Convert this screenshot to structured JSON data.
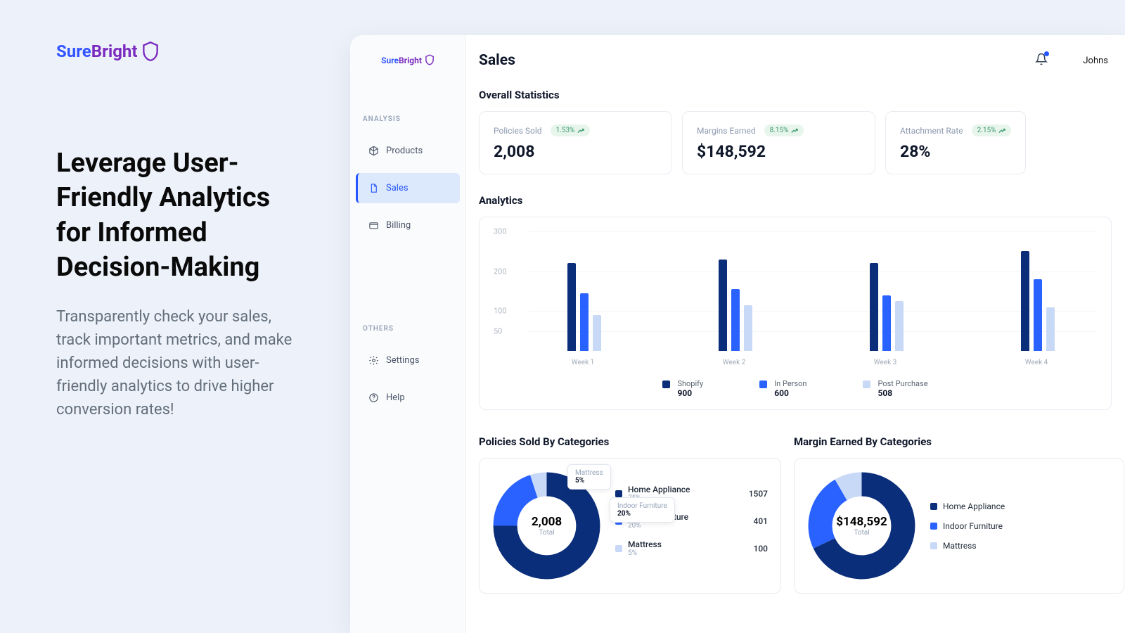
{
  "brand": {
    "sure": "Sure",
    "bright": "Bright"
  },
  "marketing": {
    "headline": "Leverage User-Friendly Analytics for Informed Decision-Making",
    "body": "Transparently check your sales, track important metrics, and make informed decisions with user-friendly analytics to drive higher conversion rates!"
  },
  "sidebar": {
    "section1": "ANALYSIS",
    "section2": "OTHERS",
    "items1": [
      {
        "label": "Products",
        "icon": "cube"
      },
      {
        "label": "Sales",
        "icon": "file",
        "active": true
      },
      {
        "label": "Billing",
        "icon": "card"
      }
    ],
    "items2": [
      {
        "label": "Settings",
        "icon": "gear"
      },
      {
        "label": "Help",
        "icon": "help"
      }
    ]
  },
  "page": {
    "title": "Sales",
    "user": "Johns"
  },
  "sections": {
    "overall": "Overall Statistics",
    "analytics": "Analytics",
    "policies_cat": "Policies Sold By Categories",
    "margin_cat": "Margin Earned By Categories"
  },
  "stats": [
    {
      "label": "Policies Sold",
      "delta": "1.53%",
      "value": "2,008"
    },
    {
      "label": "Margins Earned",
      "delta": "8.15%",
      "value": "$148,592"
    },
    {
      "label": "Attachment Rate",
      "delta": "2.15%",
      "value": "28%"
    }
  ],
  "chart_data": {
    "type": "bar",
    "ylim": [
      0,
      300
    ],
    "yticks": [
      50,
      100,
      200,
      300
    ],
    "categories": [
      "Week 1",
      "Week 2",
      "Week 3",
      "Week 4"
    ],
    "series": [
      {
        "name": "Shopify",
        "color": "#0b2e7a",
        "total": "900",
        "values": [
          220,
          230,
          220,
          250
        ]
      },
      {
        "name": "In Person",
        "color": "#2a62ff",
        "total": "600",
        "values": [
          145,
          155,
          140,
          180
        ]
      },
      {
        "name": "Post Purchase",
        "color": "#c8d8f7",
        "total": "508",
        "values": [
          90,
          115,
          125,
          110
        ]
      }
    ]
  },
  "donut_policies": {
    "center_value": "2,008",
    "center_label": "Total",
    "tooltips": [
      {
        "label": "Mattress",
        "val": "5%"
      },
      {
        "label": "Indoor Furniture",
        "val": "20%"
      }
    ],
    "slices": [
      {
        "name": "Home Appliance",
        "pct": "75%",
        "count": "1507",
        "color": "#0b2e7a",
        "deg": 270
      },
      {
        "name": "Indoor Furniture",
        "pct": "20%",
        "count": "401",
        "color": "#2a62ff",
        "deg": 72
      },
      {
        "name": "Mattress",
        "pct": "5%",
        "count": "100",
        "color": "#c8d8f7",
        "deg": 18
      }
    ]
  },
  "donut_margin": {
    "center_value": "$148,592",
    "center_label": "Total",
    "slices": [
      {
        "name": "Home Appliance",
        "color": "#0b2e7a",
        "deg": 245
      },
      {
        "name": "Indoor Furniture",
        "color": "#2a62ff",
        "deg": 85
      },
      {
        "name": "Mattress",
        "color": "#c8d8f7",
        "deg": 30
      }
    ]
  }
}
